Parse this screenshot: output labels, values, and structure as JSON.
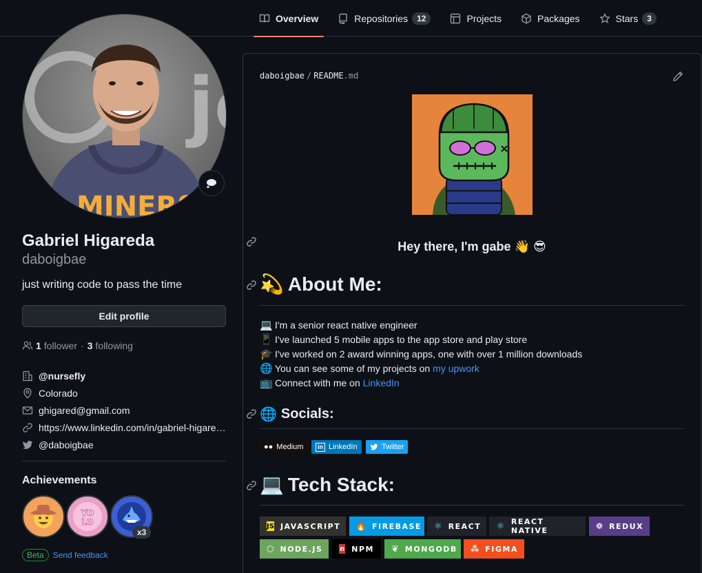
{
  "nav": {
    "tabs": [
      {
        "label": "Overview",
        "icon": "book-icon",
        "active": true
      },
      {
        "label": "Repositories",
        "icon": "repo-icon",
        "count": "12"
      },
      {
        "label": "Projects",
        "icon": "table-icon"
      },
      {
        "label": "Packages",
        "icon": "package-icon"
      },
      {
        "label": "Stars",
        "icon": "star-icon",
        "count": "3"
      }
    ]
  },
  "profile": {
    "full_name": "Gabriel Higareda",
    "username": "daboigbae",
    "bio": "just writing code to pass the time",
    "edit_label": "Edit profile",
    "followers_count": "1",
    "followers_label": "follower",
    "following_count": "3",
    "following_label": "following",
    "details": {
      "org": "@nursefly",
      "location": "Colorado",
      "email": "ghigared@gmail.com",
      "website": "https://www.linkedin.com/in/gabriel-higareda",
      "twitter": "@daboigbae"
    },
    "achievements_title": "Achievements",
    "badge_multiplier": "x3",
    "beta_label": "Beta",
    "feedback_label": "Send feedback"
  },
  "readme": {
    "owner": "daboigbae",
    "file_name": "README",
    "file_ext": ".md",
    "greeting": "Hey there, I'm gabe",
    "greeting_emoji": "👋 😎",
    "about_title": "About Me:",
    "about_emoji": "💫",
    "about_items": [
      {
        "emoji": "💻",
        "text": "I'm a senior react native engineer"
      },
      {
        "emoji": "📱",
        "text": "I've launched 5 mobile apps to the app store and play store"
      },
      {
        "emoji": "🎓",
        "text": "I've worked on 2 award winning apps, one with over 1 million downloads"
      },
      {
        "emoji": "🌐",
        "text": "You can see some of my projects on",
        "link": "my upwork"
      },
      {
        "emoji": "📺",
        "text": "Connect with me on",
        "link": "LinkedIn"
      }
    ],
    "socials_title": "Socials:",
    "socials_emoji": "🌐",
    "socials": [
      {
        "label": "Medium",
        "icon": "medium-icon",
        "color": "#12100e"
      },
      {
        "label": "LinkedIn",
        "icon": "linkedin-icon",
        "color": "#0077b5"
      },
      {
        "label": "Twitter",
        "icon": "twitter-icon",
        "color": "#1ca0f1"
      }
    ],
    "tech_title": "Tech Stack:",
    "tech_emoji": "💻",
    "tech": [
      {
        "label": "JAVASCRIPT",
        "color": "#323330",
        "icon_color": "#f7df1e"
      },
      {
        "label": "FIREBASE",
        "color": "#039be5",
        "icon_color": "#ffca28"
      },
      {
        "label": "REACT",
        "color": "#20232a",
        "icon_color": "#61dafb"
      },
      {
        "label": "REACT NATIVE",
        "color": "#20232a",
        "icon_color": "#61dafb"
      },
      {
        "label": "REDUX",
        "color": "#593d88",
        "icon_color": "#ffffff"
      },
      {
        "label": "NODE.JS",
        "color": "#6da55f",
        "icon_color": "#ffffff"
      },
      {
        "label": "NPM",
        "color": "#000000",
        "icon_color": "#cb3837"
      },
      {
        "label": "MONGODB",
        "color": "#4ea94b",
        "icon_color": "#ffffff"
      },
      {
        "label": "FIGMA",
        "color": "#f24e1e",
        "icon_color": "#ffffff"
      }
    ]
  }
}
